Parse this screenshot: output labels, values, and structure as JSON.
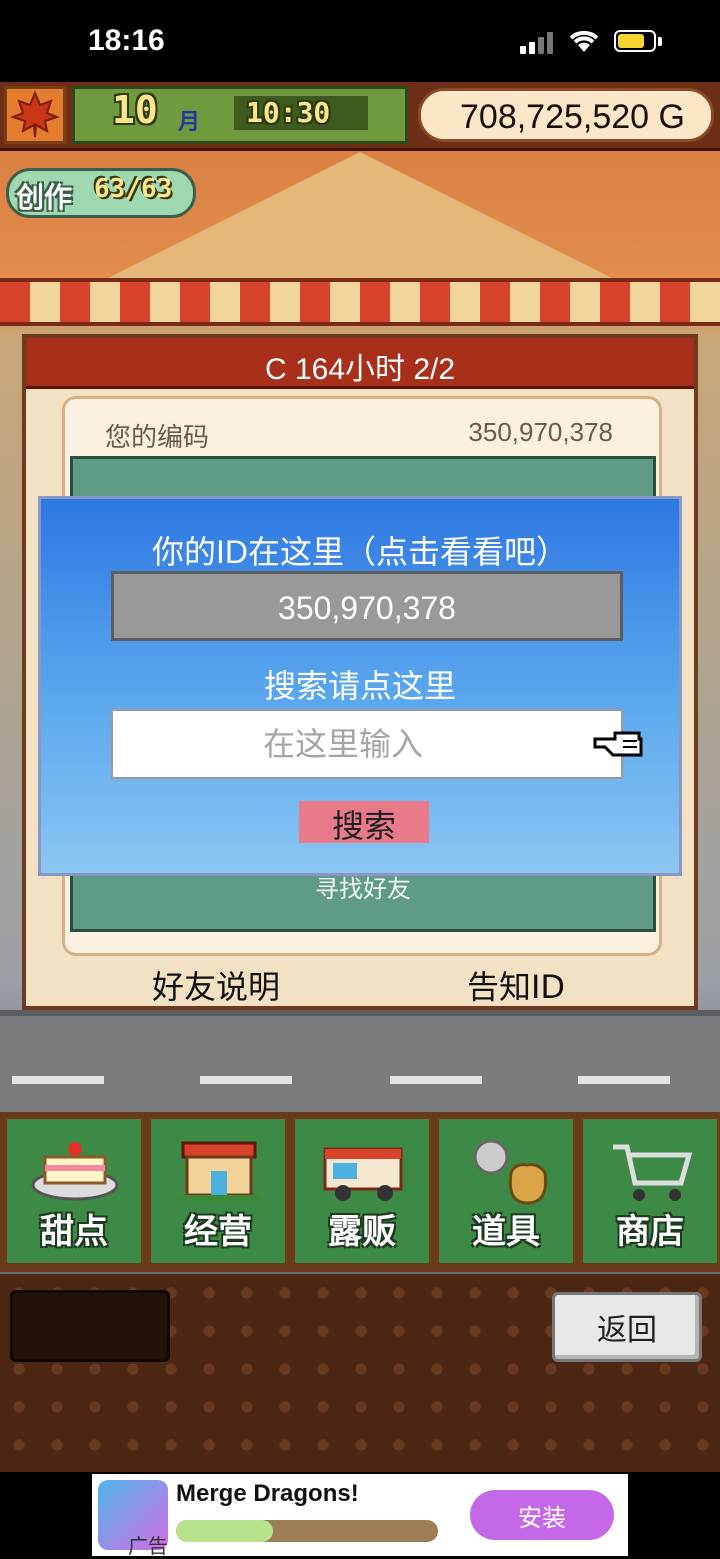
{
  "status_bar": {
    "time": "18:16"
  },
  "hud": {
    "month": "10",
    "month_unit": "月",
    "clock": "10:30",
    "money": "708,725,520 G",
    "create_label": "创作",
    "create_count": "63/63"
  },
  "panel": {
    "title": "C 164小时 2/2",
    "code_label": "您的编码",
    "code_value": "350,970,378",
    "find_friend": "寻找好友",
    "friend_help": "好友说明",
    "tell_id": "告知ID"
  },
  "dialog": {
    "title": "你的ID在这里（点击看看吧）",
    "id_value": "350,970,378",
    "search_hint": "搜索请点这里",
    "input_placeholder": "在这里输入",
    "search_button": "搜索"
  },
  "menu": {
    "items": [
      {
        "label": "甜点",
        "icon": "cake-icon"
      },
      {
        "label": "经营",
        "icon": "shop-icon"
      },
      {
        "label": "露贩",
        "icon": "food-truck-icon"
      },
      {
        "label": "道具",
        "icon": "item-bag-icon"
      },
      {
        "label": "商店",
        "icon": "cart-icon"
      }
    ],
    "back": "返回"
  },
  "ad": {
    "title": "Merge Dragons!",
    "label": "广告",
    "install": "安装",
    "progress": 0.37
  },
  "colors": {
    "accent_red": "#a8301b",
    "dialog_blue": "#2e78e3",
    "menu_green": "#3d8a47",
    "install_purple": "#c568e8"
  }
}
